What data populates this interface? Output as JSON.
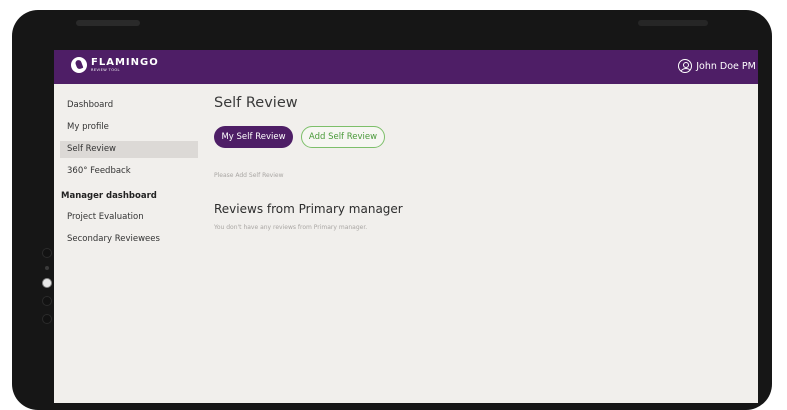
{
  "app": {
    "logo_title": "FLAMINGO",
    "logo_subtitle": "REVIEW TOOL",
    "user_name": "John Doe PM",
    "user_separator": "|"
  },
  "sidebar": {
    "items": [
      {
        "label": "Dashboard",
        "active": false
      },
      {
        "label": "My profile",
        "active": false
      },
      {
        "label": "Self Review",
        "active": true
      },
      {
        "label": "360° Feedback",
        "active": false
      }
    ],
    "manager_section_title": "Manager dashboard",
    "manager_items": [
      {
        "label": "Project Evaluation"
      },
      {
        "label": "Secondary Reviewees"
      }
    ]
  },
  "main": {
    "title": "Self Review",
    "tabs": {
      "my_self_review": "My Self Review",
      "add_self_review": "Add Self Review"
    },
    "empty_self_review_text": "Please Add Self Review",
    "primary_manager_section_title": "Reviews from Primary manager",
    "primary_manager_empty_text": "You don't have any reviews from Primary manager."
  },
  "colors": {
    "header": "#4e1e66",
    "primary_button": "#4e1e66",
    "outline_button_border": "#7dbf6a",
    "background": "#f1efec"
  }
}
